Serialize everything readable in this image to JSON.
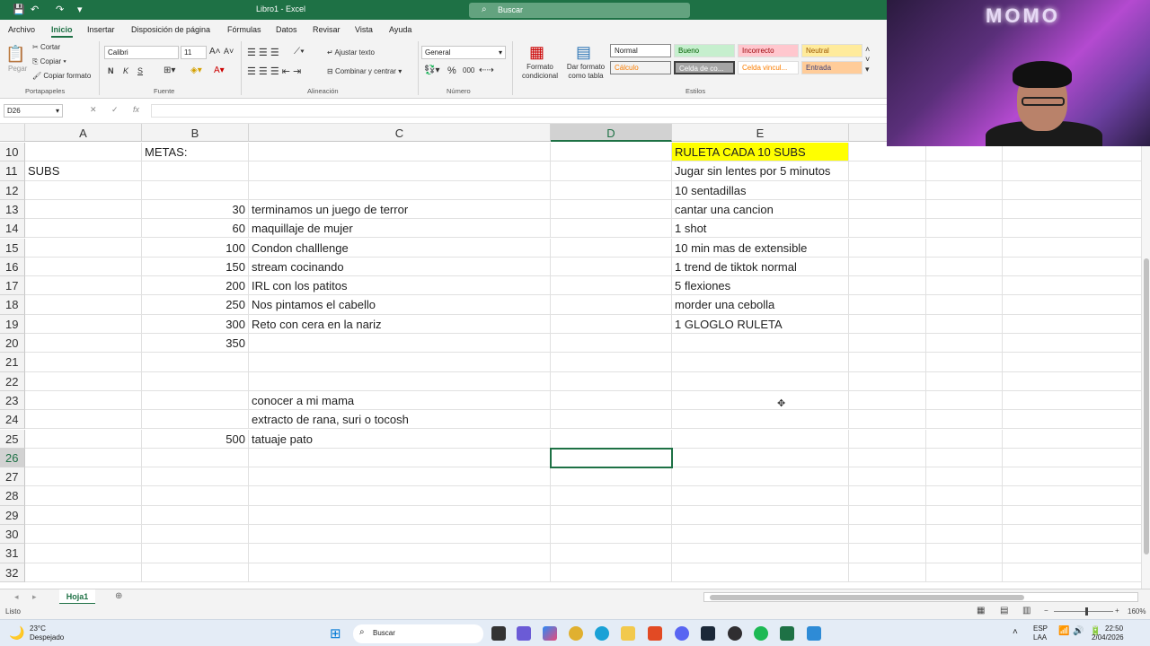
{
  "titlebar": {
    "file": "Libro1",
    "sep": " - ",
    "app": "Excel",
    "search_placeholder": "Buscar"
  },
  "menu": [
    "Archivo",
    "Inicio",
    "Insertar",
    "Disposición de página",
    "Fórmulas",
    "Datos",
    "Revisar",
    "Vista",
    "Ayuda"
  ],
  "ribbon": {
    "clipboard": {
      "paste": "Pegar",
      "cut": "Cortar",
      "copy": "Copiar",
      "format_painter": "Copiar formato",
      "group": "Portapapeles"
    },
    "font": {
      "name": "Calibri",
      "size": "11",
      "bold": "N",
      "italic": "K",
      "underline": "S",
      "group": "Fuente"
    },
    "alignment": {
      "wrap": "Ajustar texto",
      "merge": "Combinar y centrar",
      "group": "Alineación"
    },
    "number": {
      "format": "General",
      "percent": "%",
      "thousands": "000",
      "group": "Número"
    },
    "styles": {
      "conditional": "Formato condicional",
      "as_table": "Dar formato como tabla",
      "group": "Estilos",
      "cells": [
        "Normal",
        "Bueno",
        "Incorrecto",
        "Neutral",
        "Cálculo",
        "Celda de co...",
        "Celda vincul...",
        "Entrada"
      ]
    }
  },
  "formula_bar": {
    "name_box": "D26",
    "fx": "fx",
    "value": ""
  },
  "columns": [
    "A",
    "B",
    "C",
    "D",
    "E"
  ],
  "rows": [
    {
      "n": "10",
      "a": "",
      "b": "METAS:",
      "c": "",
      "e": "RULETA CADA 10 SUBS"
    },
    {
      "n": "11",
      "a": "SUBS",
      "b": "",
      "c": "",
      "e": "Jugar sin lentes por 5 minutos"
    },
    {
      "n": "12",
      "a": "",
      "b": "",
      "c": "",
      "e": "10 sentadillas"
    },
    {
      "n": "13",
      "a": "",
      "b": "30",
      "c": "terminamos un juego de terror",
      "e": "cantar una cancion"
    },
    {
      "n": "14",
      "a": "",
      "b": "60",
      "c": "maquillaje de mujer",
      "e": "1 shot"
    },
    {
      "n": "15",
      "a": "",
      "b": "100",
      "c": "Condon challlenge",
      "e": "10 min mas de extensible"
    },
    {
      "n": "16",
      "a": "",
      "b": "150",
      "c": "stream cocinando",
      "e": "1 trend de tiktok normal"
    },
    {
      "n": "17",
      "a": "",
      "b": "200",
      "c": "IRL con los patitos",
      "e": "5 flexiones"
    },
    {
      "n": "18",
      "a": "",
      "b": "250",
      "c": "Nos pintamos el cabello",
      "e": "morder una cebolla"
    },
    {
      "n": "19",
      "a": "",
      "b": "300",
      "c": "Reto con cera en la nariz",
      "e": "1 GLOGLO RULETA"
    },
    {
      "n": "20",
      "a": "",
      "b": "350",
      "c": "",
      "e": ""
    },
    {
      "n": "21",
      "a": "",
      "b": "",
      "c": "",
      "e": ""
    },
    {
      "n": "22",
      "a": "",
      "b": "",
      "c": "",
      "e": ""
    },
    {
      "n": "23",
      "a": "",
      "b": "",
      "c": "conocer a mi mama",
      "e": ""
    },
    {
      "n": "24",
      "a": "",
      "b": "",
      "c": "extracto de rana, suri o tocosh",
      "e": ""
    },
    {
      "n": "25",
      "a": "",
      "b": "500",
      "c": "tatuaje pato",
      "e": ""
    },
    {
      "n": "26",
      "a": "",
      "b": "",
      "c": "",
      "e": ""
    },
    {
      "n": "27",
      "a": "",
      "b": "",
      "c": "",
      "e": ""
    },
    {
      "n": "28",
      "a": "",
      "b": "",
      "c": "",
      "e": ""
    },
    {
      "n": "29",
      "a": "",
      "b": "",
      "c": "",
      "e": ""
    },
    {
      "n": "30",
      "a": "",
      "b": "",
      "c": "",
      "e": ""
    },
    {
      "n": "31",
      "a": "",
      "b": "",
      "c": "",
      "e": ""
    },
    {
      "n": "32",
      "a": "",
      "b": "",
      "c": "",
      "e": ""
    }
  ],
  "highlight_color": "#ffff00",
  "accent": "#1e7145",
  "sheet_tab": "Hoja1",
  "status": {
    "ready": "Listo",
    "zoom": "160%"
  },
  "taskbar": {
    "temp": "23°C",
    "weather": "Despejado",
    "search": "Buscar",
    "lang1": "ESP",
    "lang2": "LAA",
    "time": "22:50",
    "date": "2/04/2026"
  },
  "webcam_sign": "MOMO"
}
